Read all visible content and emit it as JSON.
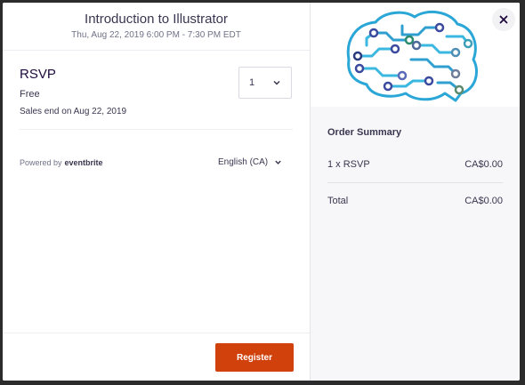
{
  "event": {
    "title": "Introduction to Illustrator",
    "datetime": "Thu, Aug 22, 2019 6:00 PM - 7:30 PM EDT"
  },
  "ticket": {
    "name": "RSVP",
    "price": "Free",
    "sales_end": "Sales end on Aug 22, 2019",
    "quantity": "1"
  },
  "footer": {
    "powered_prefix": "Powered by",
    "powered_brand": "eventbrite",
    "language": "English (CA)",
    "register_label": "Register"
  },
  "order_summary": {
    "title": "Order Summary",
    "items": [
      {
        "label": "1 x RSVP",
        "amount": "CA$0.00"
      }
    ],
    "total_label": "Total",
    "total_amount": "CA$0.00"
  },
  "icons": {
    "close": "close-icon",
    "quantity_chevron": "chevron-down-icon",
    "language_chevron": "chevron-down-icon",
    "banner": "circuit-brain-illustration"
  },
  "colors": {
    "accent": "#d1410c",
    "brain_stroke": "#2aa7d6",
    "sidebar_bg": "#f7f7f9"
  }
}
